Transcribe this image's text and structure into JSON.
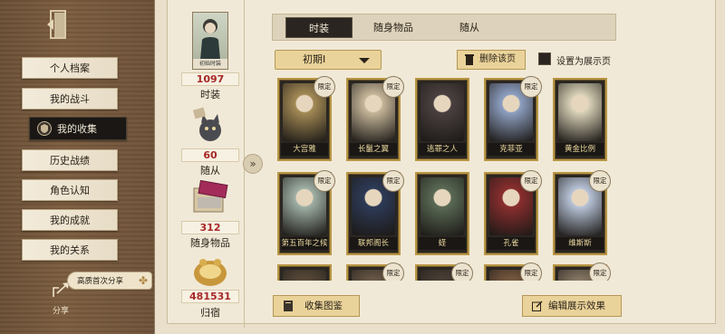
{
  "sidebar": {
    "items": [
      {
        "label": "个人档案"
      },
      {
        "label": "我的战斗"
      },
      {
        "label": "我的收集"
      },
      {
        "label": "历史战绩"
      },
      {
        "label": "角色认知"
      },
      {
        "label": "我的成就"
      },
      {
        "label": "我的关系"
      }
    ],
    "active_index": 2,
    "share_pill": "高质首次分享",
    "share_label": "分享"
  },
  "stats": {
    "avatar_tag": "初始时装",
    "costumes": {
      "value": "1097",
      "label": "时装"
    },
    "followers": {
      "value": "60",
      "label": "随从"
    },
    "items": {
      "value": "312",
      "label": "随身物品"
    },
    "home": {
      "value": "481531",
      "label": "归宿"
    }
  },
  "tabs": [
    {
      "label": "时装",
      "active": true
    },
    {
      "label": "随身物品",
      "active": false
    },
    {
      "label": "随从",
      "active": false
    }
  ],
  "filter": {
    "dropdown_value": "初期Ⅰ",
    "delete_label": "删除该页",
    "checkbox_label": "设置为展示页"
  },
  "cards": [
    {
      "name": "大宫雅",
      "badge": "限定",
      "art": "#a48a55"
    },
    {
      "name": "长鬣之翼",
      "badge": "限定",
      "art": "#c7b79a"
    },
    {
      "name": "逃罪之人",
      "badge": "",
      "art": "#4a4040"
    },
    {
      "name": "克菲亚",
      "badge": "限定",
      "art": "#8ea0c2"
    },
    {
      "name": "黄金比例",
      "badge": "",
      "art": "#d9d1b7"
    },
    {
      "name": "第五百年之候",
      "badge": "限定",
      "art": "#9fb0a5"
    },
    {
      "name": "联邦阁长",
      "badge": "限定",
      "art": "#2d3a57"
    },
    {
      "name": "蛏",
      "badge": "",
      "art": "#5a6a55"
    },
    {
      "name": "孔雀",
      "badge": "限定",
      "art": "#8a2e2e"
    },
    {
      "name": "维斯斯",
      "badge": "限定",
      "art": "#b8c4d8"
    },
    {
      "name": "",
      "badge": "",
      "art": "#5a4b3a"
    },
    {
      "name": "",
      "badge": "限定",
      "art": "#6b5a48"
    },
    {
      "name": "",
      "badge": "限定",
      "art": "#4b4036"
    },
    {
      "name": "",
      "badge": "限定",
      "art": "#7a5a40"
    },
    {
      "name": "",
      "badge": "限定",
      "art": "#8a7a66"
    }
  ],
  "bottom": {
    "gallery_label": "收集图鉴",
    "edit_label": "编辑展示效果"
  },
  "colors": {
    "accent_gold": "#ead39a",
    "stat_red": "#a82828",
    "dark": "#2a2520"
  },
  "icons": [
    "exit-door-icon",
    "shield-icon",
    "share-icon",
    "clover-icon",
    "trash-icon",
    "book-icon",
    "edit-icon",
    "double-chevron-right-icon"
  ]
}
